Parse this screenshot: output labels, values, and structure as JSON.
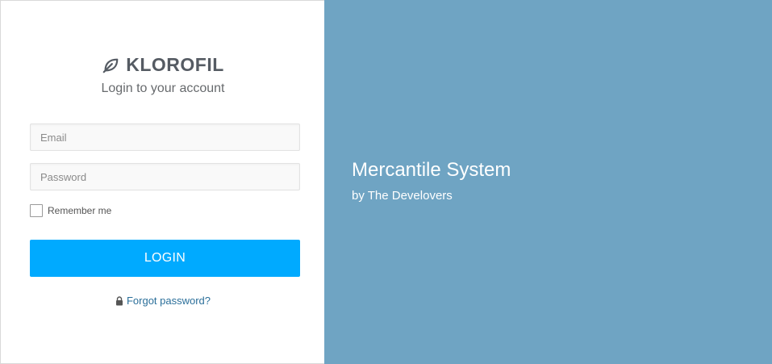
{
  "brand": {
    "icon": "leaf-icon",
    "name": "KLOROFIL",
    "subtitle": "Login to your account"
  },
  "form": {
    "email_placeholder": "Email",
    "email_value": "",
    "password_placeholder": "Password",
    "password_value": "",
    "remember_label": "Remember me",
    "remember_checked": false,
    "login_label": "LOGIN",
    "forgot_icon": "lock-icon",
    "forgot_label": "Forgot password?"
  },
  "hero": {
    "title": "Mercantile System",
    "subtitle": "by The Develovers"
  },
  "colors": {
    "accent": "#00aaff",
    "panel": "#6fa4c3",
    "link": "#2b6f9a",
    "brand_text": "#555b63"
  }
}
